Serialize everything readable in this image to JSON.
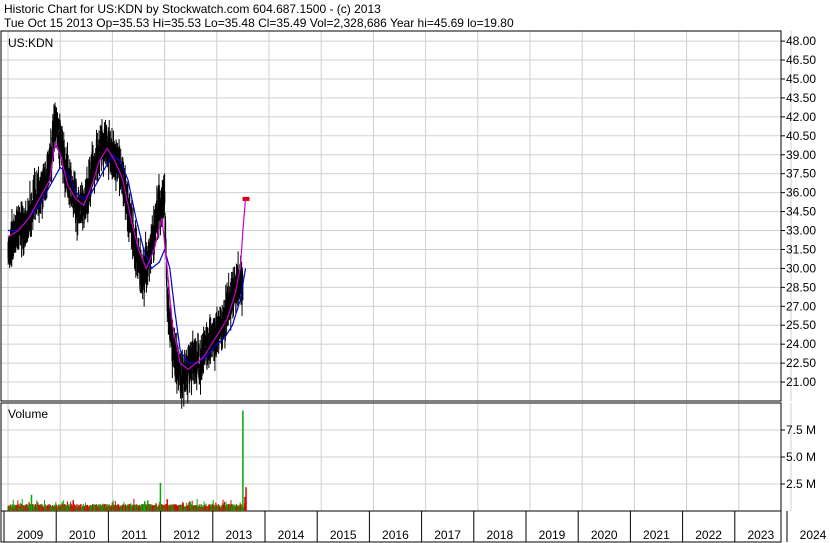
{
  "header": {
    "line1": "Historic Chart for US:KDN by Stockwatch.com 604.687.1500 - (c) 2013",
    "line2": "Tue Oct 15 2013   Op=35.53   Hi=35.53   Lo=35.48   Cl=35.49   Vol=2,328,686   Year hi=45.69   lo=19.80"
  },
  "colors": {
    "price_bar": "#000000",
    "ma_fast": "#cc00cc",
    "ma_slow": "#0000cc",
    "vol_up": "#00aa00",
    "vol_down": "#dd0000",
    "grid": "#d0d0d0",
    "last_marker": "#dd0000"
  },
  "chart_data": [
    {
      "type": "line",
      "symbol_label": "US:KDN",
      "title": "",
      "ylim": [
        19.5,
        48.8
      ],
      "y_ticks": [
        "48.00",
        "46.50",
        "45.00",
        "43.50",
        "42.00",
        "40.50",
        "39.00",
        "37.50",
        "36.00",
        "34.50",
        "33.00",
        "31.50",
        "30.00",
        "28.50",
        "27.00",
        "25.50",
        "24.00",
        "22.50",
        "21.00"
      ],
      "x_ticks": [
        "2009",
        "2010",
        "2011",
        "2012",
        "2013",
        "2014",
        "2015",
        "2016",
        "2017",
        "2018",
        "2019",
        "2020",
        "2021",
        "2022",
        "2023",
        "2024"
      ],
      "price_anchors": [
        {
          "x": 2009.0,
          "y": 31.5
        },
        {
          "x": 2009.1,
          "y": 32.5
        },
        {
          "x": 2009.2,
          "y": 33.5
        },
        {
          "x": 2009.3,
          "y": 33.0
        },
        {
          "x": 2009.4,
          "y": 34.0
        },
        {
          "x": 2009.5,
          "y": 35.5
        },
        {
          "x": 2009.6,
          "y": 36.0
        },
        {
          "x": 2009.7,
          "y": 36.5
        },
        {
          "x": 2009.8,
          "y": 38.0
        },
        {
          "x": 2009.9,
          "y": 41.5
        },
        {
          "x": 2010.0,
          "y": 40.0
        },
        {
          "x": 2010.1,
          "y": 38.0
        },
        {
          "x": 2010.2,
          "y": 36.5
        },
        {
          "x": 2010.3,
          "y": 35.0
        },
        {
          "x": 2010.4,
          "y": 34.5
        },
        {
          "x": 2010.5,
          "y": 35.5
        },
        {
          "x": 2010.6,
          "y": 37.5
        },
        {
          "x": 2010.75,
          "y": 39.5
        },
        {
          "x": 2010.9,
          "y": 39.5
        },
        {
          "x": 2011.0,
          "y": 39.0
        },
        {
          "x": 2011.1,
          "y": 38.5
        },
        {
          "x": 2011.2,
          "y": 37.0
        },
        {
          "x": 2011.3,
          "y": 35.0
        },
        {
          "x": 2011.4,
          "y": 32.5
        },
        {
          "x": 2011.5,
          "y": 30.5
        },
        {
          "x": 2011.6,
          "y": 29.5
        },
        {
          "x": 2011.7,
          "y": 31.0
        },
        {
          "x": 2011.8,
          "y": 33.0
        },
        {
          "x": 2011.9,
          "y": 35.0
        },
        {
          "x": 2012.0,
          "y": 35.5
        },
        {
          "x": 2012.05,
          "y": 28.0
        },
        {
          "x": 2012.15,
          "y": 24.0
        },
        {
          "x": 2012.25,
          "y": 22.5
        },
        {
          "x": 2012.35,
          "y": 21.0
        },
        {
          "x": 2012.45,
          "y": 22.0
        },
        {
          "x": 2012.55,
          "y": 23.0
        },
        {
          "x": 2012.65,
          "y": 22.5
        },
        {
          "x": 2012.75,
          "y": 23.5
        },
        {
          "x": 2012.85,
          "y": 24.0
        },
        {
          "x": 2012.95,
          "y": 24.5
        },
        {
          "x": 2013.05,
          "y": 25.0
        },
        {
          "x": 2013.15,
          "y": 26.0
        },
        {
          "x": 2013.25,
          "y": 27.5
        },
        {
          "x": 2013.35,
          "y": 28.5
        },
        {
          "x": 2013.45,
          "y": 29.0
        },
        {
          "x": 2013.5,
          "y": 28.5
        }
      ],
      "last_price": {
        "x": 2013.55,
        "y": 35.5
      },
      "ma_fast": [
        {
          "x": 2009.0,
          "y": 32.5
        },
        {
          "x": 2009.2,
          "y": 33.0
        },
        {
          "x": 2009.4,
          "y": 34.0
        },
        {
          "x": 2009.6,
          "y": 35.5
        },
        {
          "x": 2009.8,
          "y": 37.0
        },
        {
          "x": 2009.9,
          "y": 40.0
        },
        {
          "x": 2010.0,
          "y": 39.0
        },
        {
          "x": 2010.15,
          "y": 36.5
        },
        {
          "x": 2010.3,
          "y": 35.5
        },
        {
          "x": 2010.45,
          "y": 35.0
        },
        {
          "x": 2010.6,
          "y": 36.5
        },
        {
          "x": 2010.75,
          "y": 38.5
        },
        {
          "x": 2010.9,
          "y": 39.5
        },
        {
          "x": 2011.05,
          "y": 38.5
        },
        {
          "x": 2011.2,
          "y": 37.0
        },
        {
          "x": 2011.35,
          "y": 34.0
        },
        {
          "x": 2011.5,
          "y": 31.5
        },
        {
          "x": 2011.65,
          "y": 30.0
        },
        {
          "x": 2011.8,
          "y": 31.5
        },
        {
          "x": 2011.95,
          "y": 34.0
        },
        {
          "x": 2012.05,
          "y": 30.0
        },
        {
          "x": 2012.15,
          "y": 25.5
        },
        {
          "x": 2012.3,
          "y": 22.5
        },
        {
          "x": 2012.45,
          "y": 22.0
        },
        {
          "x": 2012.6,
          "y": 22.5
        },
        {
          "x": 2012.75,
          "y": 23.0
        },
        {
          "x": 2012.9,
          "y": 24.0
        },
        {
          "x": 2013.05,
          "y": 25.0
        },
        {
          "x": 2013.2,
          "y": 26.0
        },
        {
          "x": 2013.35,
          "y": 28.0
        },
        {
          "x": 2013.45,
          "y": 30.0
        },
        {
          "x": 2013.5,
          "y": 33.0
        },
        {
          "x": 2013.55,
          "y": 35.5
        }
      ],
      "ma_slow": [
        {
          "x": 2009.0,
          "y": 33.0
        },
        {
          "x": 2009.2,
          "y": 33.0
        },
        {
          "x": 2009.4,
          "y": 34.0
        },
        {
          "x": 2009.6,
          "y": 35.0
        },
        {
          "x": 2009.8,
          "y": 36.5
        },
        {
          "x": 2010.0,
          "y": 38.0
        },
        {
          "x": 2010.15,
          "y": 37.5
        },
        {
          "x": 2010.3,
          "y": 36.0
        },
        {
          "x": 2010.45,
          "y": 35.5
        },
        {
          "x": 2010.6,
          "y": 36.0
        },
        {
          "x": 2010.8,
          "y": 37.5
        },
        {
          "x": 2011.0,
          "y": 39.0
        },
        {
          "x": 2011.15,
          "y": 38.5
        },
        {
          "x": 2011.3,
          "y": 37.0
        },
        {
          "x": 2011.45,
          "y": 34.0
        },
        {
          "x": 2011.6,
          "y": 31.5
        },
        {
          "x": 2011.75,
          "y": 30.0
        },
        {
          "x": 2011.9,
          "y": 30.5
        },
        {
          "x": 2012.0,
          "y": 31.5
        },
        {
          "x": 2012.1,
          "y": 30.0
        },
        {
          "x": 2012.2,
          "y": 26.5
        },
        {
          "x": 2012.3,
          "y": 23.5
        },
        {
          "x": 2012.45,
          "y": 22.5
        },
        {
          "x": 2012.6,
          "y": 22.5
        },
        {
          "x": 2012.8,
          "y": 23.0
        },
        {
          "x": 2013.0,
          "y": 24.0
        },
        {
          "x": 2013.15,
          "y": 24.5
        },
        {
          "x": 2013.3,
          "y": 25.5
        },
        {
          "x": 2013.45,
          "y": 27.5
        },
        {
          "x": 2013.55,
          "y": 30.0
        }
      ]
    },
    {
      "type": "bar",
      "title": "Volume",
      "ylim": [
        0,
        10000000
      ],
      "y_ticks": [
        {
          "v": 7500000,
          "label": "7.5 M"
        },
        {
          "v": 5000000,
          "label": "5.0 M"
        },
        {
          "v": 2500000,
          "label": "2.5 M"
        }
      ],
      "spikes": [
        {
          "x": 2009.45,
          "v": 1500000,
          "dir": "up"
        },
        {
          "x": 2010.25,
          "v": 1000000,
          "dir": "down"
        },
        {
          "x": 2011.35,
          "v": 700000,
          "dir": "up"
        },
        {
          "x": 2011.62,
          "v": 900000,
          "dir": "up"
        },
        {
          "x": 2011.92,
          "v": 2600000,
          "dir": "up"
        },
        {
          "x": 2012.05,
          "v": 1100000,
          "dir": "down"
        },
        {
          "x": 2013.5,
          "v": 9300000,
          "dir": "up"
        },
        {
          "x": 2013.54,
          "v": 1300000,
          "dir": "down"
        },
        {
          "x": 2013.56,
          "v": 2200000,
          "dir": "down"
        }
      ],
      "baseline_range": [
        150000,
        650000
      ]
    }
  ]
}
